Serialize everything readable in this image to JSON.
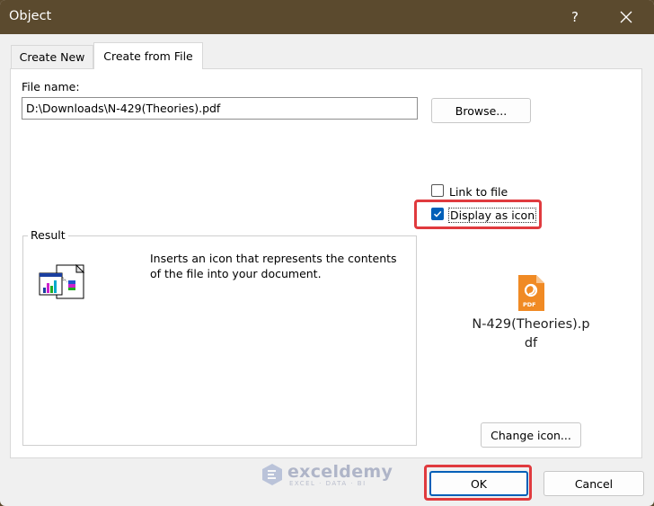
{
  "window": {
    "title": "Object",
    "help": "?"
  },
  "tabs": [
    {
      "label": "Create New"
    },
    {
      "label": "Create from File"
    }
  ],
  "file": {
    "label": "File name:",
    "value": "D:\\Downloads\\N-429(Theories).pdf",
    "browse_label": "Browse..."
  },
  "options": {
    "link_to_file": {
      "label": "Link to file",
      "checked": false
    },
    "display_as_icon": {
      "label": "Display as icon",
      "checked": true
    }
  },
  "result": {
    "title": "Result",
    "description": "Inserts an icon that represents the contents of the file into your document."
  },
  "icon_preview": {
    "icon": "pdf-file-icon",
    "badge": "PDF",
    "filename": "N-429(Theories).pdf",
    "change_icon_label": "Change icon..."
  },
  "footer": {
    "ok_label": "OK",
    "cancel_label": "Cancel"
  },
  "watermark": {
    "name": "exceldemy",
    "tagline": "EXCEL · DATA · BI"
  },
  "colors": {
    "titlebar": "#5b4a2e",
    "accent": "#005fb8",
    "highlight": "#e03a3e",
    "pdf_orange": "#f08a24"
  }
}
